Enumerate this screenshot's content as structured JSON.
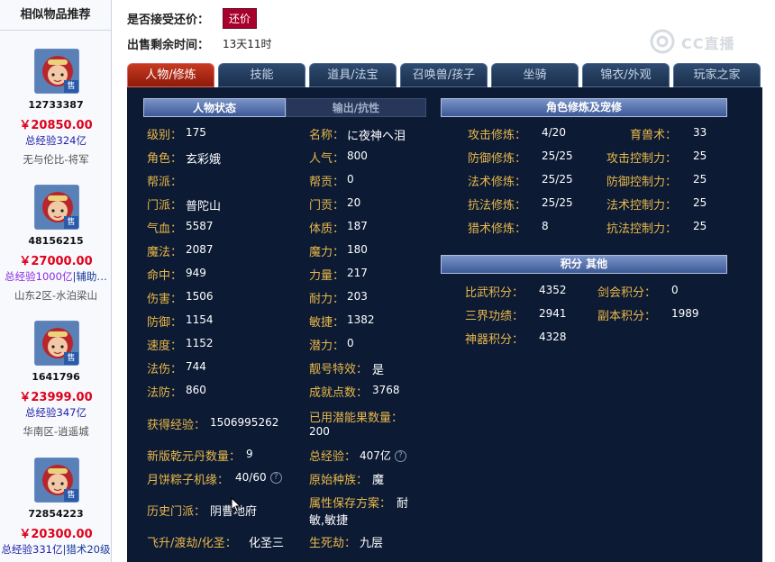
{
  "sidebar": {
    "title": "相似物品推荐",
    "items": [
      {
        "id": "12733387",
        "price": "￥20850.00",
        "exp": "总经验324亿",
        "exp_extra": "",
        "server": "无与伦比-将军"
      },
      {
        "id": "48156215",
        "price": "￥27000.00",
        "exp": "总经验1000亿",
        "exp_extra": "|辅助…",
        "server": "山东2区-水泊梁山"
      },
      {
        "id": "1641796",
        "price": "￥23999.00",
        "exp": "总经验347亿",
        "exp_extra": "",
        "server": "华南区-逍遥城"
      },
      {
        "id": "72854223",
        "price": "￥20300.00",
        "exp": "总经验331亿",
        "exp_extra": "|猎术20级",
        "server": ""
      }
    ],
    "sell_tag": "售"
  },
  "top": {
    "bargain_label": "是否接受还价：",
    "bargain_button": "还价",
    "time_label": "出售剩余时间：",
    "time_value": "13天11时"
  },
  "logo": {
    "text": "CC直播"
  },
  "tabs": [
    "人物/修炼",
    "技能",
    "道具/法宝",
    "召唤兽/孩子",
    "坐骑",
    "锦衣/外观",
    "玩家之家"
  ],
  "left_section": {
    "tab_active": "人物状态",
    "tab_inactive": "输出/抗性",
    "rows": [
      {
        "l1": "级别：",
        "v1": "175",
        "l2": "名称：",
        "v2": "に夜神ヘ泪"
      },
      {
        "l1": "角色：",
        "v1": "玄彩娥",
        "l2": "人气：",
        "v2": "800"
      },
      {
        "l1": "帮派：",
        "v1": "",
        "l2": "帮贡：",
        "v2": "0"
      },
      {
        "l1": "门派：",
        "v1": "普陀山",
        "l2": "门贡：",
        "v2": "20"
      },
      {
        "l1": "气血：",
        "v1": "5587",
        "l2": "体质：",
        "v2": "187"
      },
      {
        "l1": "魔法：",
        "v1": "2087",
        "l2": "魔力：",
        "v2": "180"
      },
      {
        "l1": "命中：",
        "v1": "949",
        "l2": "力量：",
        "v2": "217"
      },
      {
        "l1": "伤害：",
        "v1": "1506",
        "l2": "耐力：",
        "v2": "203"
      },
      {
        "l1": "防御：",
        "v1": "1154",
        "l2": "敏捷：",
        "v2": "1382"
      },
      {
        "l1": "速度：",
        "v1": "1152",
        "l2": "潜力：",
        "v2": "0"
      },
      {
        "l1": "法伤：",
        "v1": "744",
        "l2": "靓号特效：",
        "v2": "是"
      },
      {
        "l1": "法防：",
        "v1": "860",
        "l2": "成就点数：",
        "v2": "3768"
      }
    ],
    "exp_label": "获得经验：",
    "exp_value": "1506995262",
    "potential_label": "已用潜能果数量：",
    "potential_value": "200",
    "qianyuan_label": "新版乾元丹数量：",
    "qianyuan_value": "9",
    "total_exp_label": "总经验：",
    "total_exp_value": "407亿",
    "zongzi_label": "月饼粽子机缘：",
    "zongzi_value": "40/60",
    "race_label": "原始种族：",
    "race_value": "魔",
    "history_label": "历史门派：",
    "history_value": "阴曹地府",
    "attr_label": "属性保存方案：",
    "attr_value1": "耐",
    "attr_value2": "敏,敏捷",
    "ascend_label": "飞升/渡劫/化圣：",
    "ascend_value": "化圣三",
    "life_label": "生死劫：",
    "life_value": "九层",
    "help_icon": "?"
  },
  "right_section": {
    "title": "角色修炼及宠修",
    "rows": [
      {
        "l1": "攻击修炼：",
        "v1": "4/20",
        "l2": "育兽术：",
        "v2": "33"
      },
      {
        "l1": "防御修炼：",
        "v1": "25/25",
        "l2": "攻击控制力：",
        "v2": "25"
      },
      {
        "l1": "法术修炼：",
        "v1": "25/25",
        "l2": "防御控制力：",
        "v2": "25"
      },
      {
        "l1": "抗法修炼：",
        "v1": "25/25",
        "l2": "法术控制力：",
        "v2": "25"
      },
      {
        "l1": "猎术修炼：",
        "v1": "8",
        "l2": "抗法控制力：",
        "v2": "25"
      }
    ],
    "points_title": "积分 其他",
    "points": [
      {
        "l1": "比武积分：",
        "v1": "4352",
        "l2": "剑会积分：",
        "v2": "0"
      },
      {
        "l1": "三界功绩：",
        "v1": "2941",
        "l2": "副本积分：",
        "v2": "1989"
      },
      {
        "l1": "神器积分：",
        "v1": "4328",
        "l2": "",
        "v2": ""
      }
    ]
  }
}
